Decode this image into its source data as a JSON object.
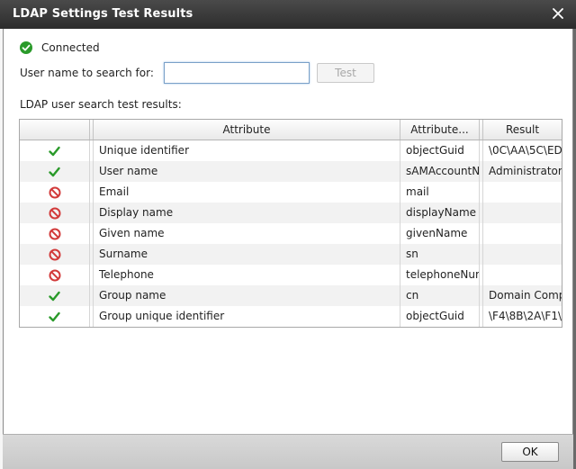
{
  "dialog": {
    "title": "LDAP Settings Test Results",
    "status_text": "Connected",
    "status_icon": "connected-check-icon",
    "search_label": "User name to search for:",
    "search_value": "",
    "test_label": "Test",
    "results_label": "LDAP user search test results:",
    "ok_label": "OK"
  },
  "colors": {
    "success": "#2a9a2a",
    "error": "#d23a3a",
    "titlebar": "#333333"
  },
  "table": {
    "headers": {
      "attribute": "Attribute",
      "attribute_name": "Attribute...",
      "result": "Result"
    },
    "rows": [
      {
        "status": "success",
        "attribute": "Unique identifier",
        "ldap": "objectGuid",
        "result": "\\0C\\AA\\5C\\ED"
      },
      {
        "status": "success",
        "attribute": "User name",
        "ldap": "sAMAccountNa",
        "result": "Administrator"
      },
      {
        "status": "error",
        "attribute": "Email",
        "ldap": "mail",
        "result": ""
      },
      {
        "status": "error",
        "attribute": "Display name",
        "ldap": "displayName",
        "result": ""
      },
      {
        "status": "error",
        "attribute": "Given name",
        "ldap": "givenName",
        "result": ""
      },
      {
        "status": "error",
        "attribute": "Surname",
        "ldap": "sn",
        "result": ""
      },
      {
        "status": "error",
        "attribute": "Telephone",
        "ldap": "telephoneNum",
        "result": ""
      },
      {
        "status": "success",
        "attribute": "Group name",
        "ldap": "cn",
        "result": "Domain Comp"
      },
      {
        "status": "success",
        "attribute": "Group unique identifier",
        "ldap": "objectGuid",
        "result": "\\F4\\8B\\2A\\F1\\"
      }
    ]
  }
}
